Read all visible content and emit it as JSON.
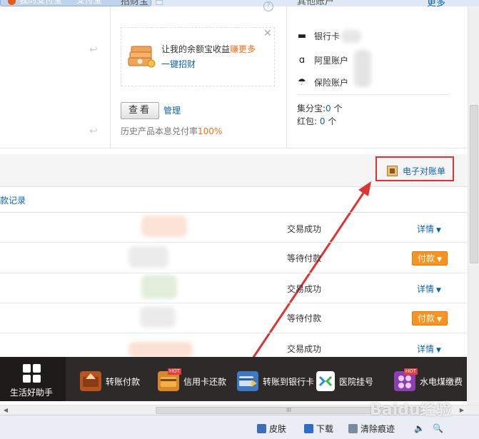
{
  "browser": {
    "tab_title": "我的支付宝 － 支付宝",
    "hscroll_grip": "III"
  },
  "left_panel": {
    "arrow_glyph": "↩"
  },
  "promo_panel": {
    "heading": "招财宝",
    "help_glyph": "?",
    "close_glyph": "✕",
    "promo_text": "让我的余额宝收益",
    "promo_highlight": "赚更多",
    "promo_link": "一键招财",
    "view_button": "查看",
    "manage_link": "管理",
    "history_text": "历史产品本息兑付率",
    "history_rate": "100%"
  },
  "accounts_panel": {
    "heading": "其他账户",
    "more_link": "更多",
    "items": [
      {
        "icon": "bank-card-icon",
        "glyph": "▬",
        "label": "银行卡"
      },
      {
        "icon": "aliyun-icon",
        "glyph": "ɑ",
        "label": "阿里账户"
      },
      {
        "icon": "umbrella-icon",
        "glyph": "☂",
        "label": "保险账户"
      }
    ],
    "jifenbao_label": "集分宝:",
    "jifenbao_value": "0",
    "jifenbao_unit": "个",
    "hongbao_label": "红包:",
    "hongbao_value": "0",
    "hongbao_unit": "个"
  },
  "statement": {
    "label": "电子对账单",
    "highlight_color": "#e03232"
  },
  "records": {
    "link": "款记录",
    "rows": [
      {
        "status": "交易成功",
        "action": "详情",
        "action_type": "link"
      },
      {
        "status": "等待付款",
        "action": "付款",
        "action_type": "button"
      },
      {
        "status": "交易成功",
        "action": "详情",
        "action_type": "link"
      },
      {
        "status": "等待付款",
        "action": "付款",
        "action_type": "button"
      },
      {
        "status": "交易成功",
        "action": "详情",
        "action_type": "link"
      }
    ]
  },
  "helper_bar": {
    "home_label": "生活好助手",
    "items": [
      {
        "label": "转账付款",
        "icon": "transfer-icon",
        "hot": false
      },
      {
        "label": "信用卡还款",
        "icon": "credit-card-icon",
        "hot": true
      },
      {
        "label": "转账到银行卡",
        "icon": "bank-transfer-icon",
        "hot": false
      },
      {
        "label": "医院挂号",
        "icon": "hospital-icon",
        "hot": false
      },
      {
        "label": "水电煤缴费",
        "icon": "utilities-icon",
        "hot": true
      }
    ],
    "hot_badge": "HOT"
  },
  "status_bar": {
    "skin": "皮肤",
    "download": "下载",
    "clear_trace": "清除痕迹"
  },
  "watermark": "Baidu经验",
  "colors": {
    "link": "#0c64b0",
    "orange": "#f36f13",
    "pay_button": "#f8931f",
    "helper_bg": "#2d2a29"
  }
}
